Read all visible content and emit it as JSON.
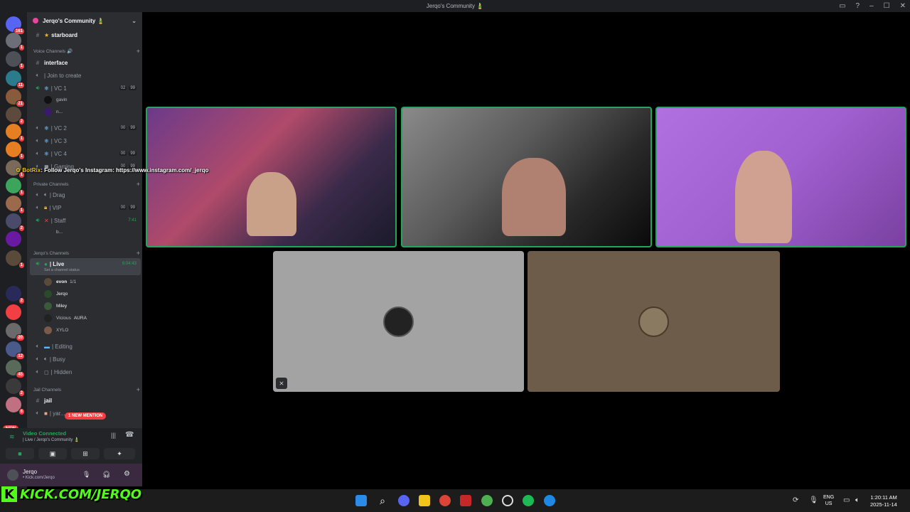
{
  "window": {
    "title": "Jerqo's Community 🎍"
  },
  "rail_badges": [
    "161",
    "1",
    "1",
    "11",
    "21",
    "2",
    "1",
    "1",
    "1",
    "1",
    "1",
    "2",
    "1",
    "2",
    "20",
    "12",
    "45",
    "2",
    "6"
  ],
  "rail_new": "NEW",
  "guild": {
    "name": "Jerqo's Community 🎍"
  },
  "channels": {
    "starboard": "starboard",
    "voice_category": "Voice Channels 🔊",
    "interface": "interface",
    "join_to_create": "| Join to create",
    "vc1": "| VC 1",
    "vc1_meta": [
      "02",
      "99"
    ],
    "vc1_members": [
      "gavin",
      "n..."
    ],
    "vc2": "| VC 2",
    "vc2_meta": [
      "00",
      "99"
    ],
    "vc3": "| VC 3",
    "vc4": "| VC 4",
    "vc4_meta": [
      "00",
      "99"
    ],
    "gaming": "| Gaming",
    "gaming_meta": [
      "00",
      "99"
    ],
    "private_category": "Private Channels",
    "drag": "| Drag",
    "vip": "| VIP",
    "vip_meta": [
      "00",
      "99"
    ],
    "staff": "| Staff",
    "staff_meta": "7:41",
    "staff_member": "b...",
    "jerqo_category": "Jerqo's Channels",
    "live": "| Live",
    "live_time": "6:04:43",
    "live_status": "Set a channel status",
    "live_members": [
      "evon",
      "Jerqo",
      "Miley",
      "Vicious",
      "XYLO"
    ],
    "evon_extra": "1/1",
    "vicious_extra": "AURA",
    "editing": "| Editing",
    "busy": "| Busy",
    "hidden": "| Hidden",
    "jail_category": "Jail Channels",
    "jail": "jail",
    "yard": "| yar...",
    "mention": "1 NEW MENTION"
  },
  "botrix": {
    "name": "BotRix",
    "message": ": Follow Jerqo's Instagram: https://www.instagram.com/_jerqo"
  },
  "voice": {
    "status": "Video Connected",
    "channel": "| Live / Jerqo's Community 🎍"
  },
  "user": {
    "name": "Jerqo",
    "status": "• Kick.com/Jerqo"
  },
  "kick": {
    "url": "KICK.COM/JERQO"
  },
  "taskbar": {
    "lang": "ENG",
    "region": "US",
    "time": "1:20:11 AM",
    "date": "2025-11-14"
  },
  "colors": {
    "accent_green": "#23a55a",
    "kick_green": "#53fc18",
    "badge_red": "#f23f43"
  }
}
